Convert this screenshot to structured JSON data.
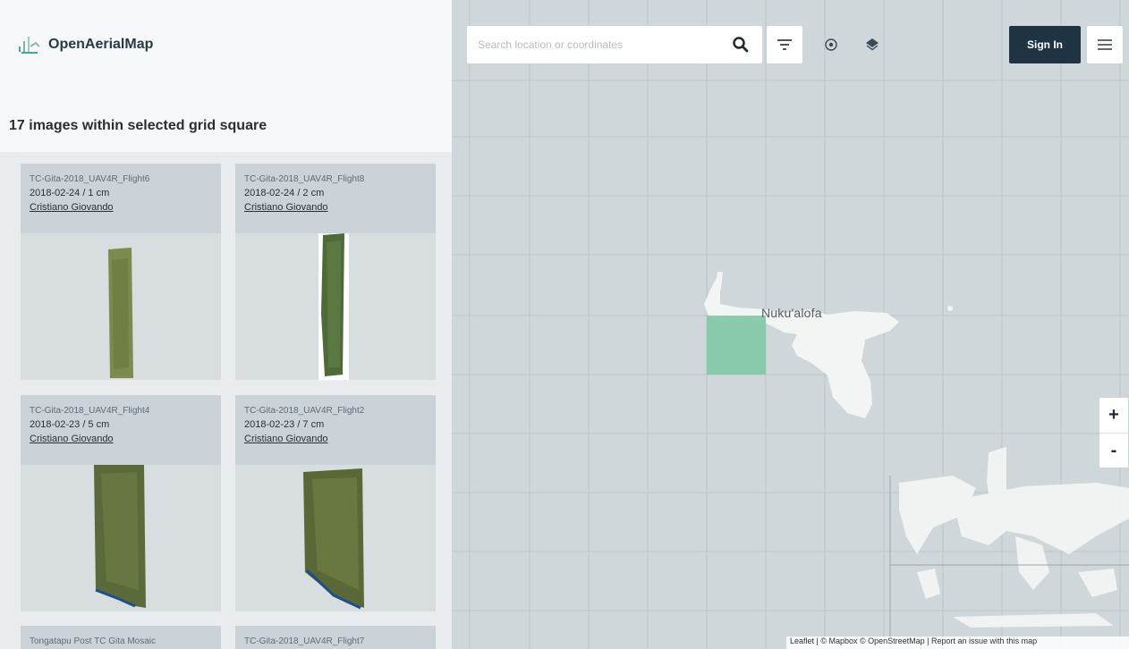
{
  "app": {
    "name": "OpenAerialMap"
  },
  "sidebar": {
    "results_title": "17 images within selected grid square",
    "cards": [
      {
        "title": "TC-Gita-2018_UAV4R_Flight6",
        "meta": "2018-02-24 / 1 cm",
        "author": "Cristiano Giovando"
      },
      {
        "title": "TC-Gita-2018_UAV4R_Flight8",
        "meta": "2018-02-24 / 2 cm",
        "author": "Cristiano Giovando"
      },
      {
        "title": "TC-Gita-2018_UAV4R_Flight4",
        "meta": "2018-02-23 / 5 cm",
        "author": "Cristiano Giovando"
      },
      {
        "title": "TC-Gita-2018_UAV4R_Flight2",
        "meta": "2018-02-23 / 7 cm",
        "author": "Cristiano Giovando"
      },
      {
        "title": "Tongatapu Post TC Gita Mosaic",
        "meta": "",
        "author": ""
      },
      {
        "title": "TC-Gita-2018_UAV4R_Flight7",
        "meta": "",
        "author": ""
      }
    ]
  },
  "map": {
    "search": {
      "placeholder": "Search location or coordinates"
    },
    "sign_in_label": "Sign In",
    "city_label": "Nuku'alofa",
    "zoom_in_label": "+",
    "zoom_out_label": "-",
    "attribution": "Leaflet | © Mapbox © OpenStreetMap | Report an issue with this map",
    "icons": [
      "search-icon",
      "filter-icon",
      "locate-icon",
      "layers-icon",
      "menu-icon"
    ],
    "colors": {
      "map_background": "#cfd7db",
      "land": "#f3f4f4",
      "selected_grid_square": "#7fc9a5",
      "sign_in_button": "#1f3343"
    }
  }
}
